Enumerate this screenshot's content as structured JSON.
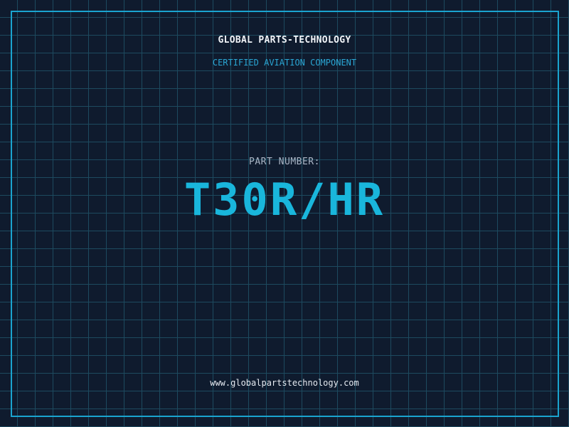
{
  "brand": {
    "company": "GLOBAL PARTS-TECHNOLOGY",
    "tagline": "CERTIFIED AVIATION COMPONENT"
  },
  "part": {
    "label": "PART NUMBER:",
    "number": "T30R/HR"
  },
  "footer": {
    "website": "www.globalpartstechnology.com"
  },
  "colors": {
    "background": "#0f1b2e",
    "grid": "#1d4a5f",
    "accent": "#19b6dc",
    "frame": "#1aa4cf",
    "text": "#f1f4f8"
  }
}
